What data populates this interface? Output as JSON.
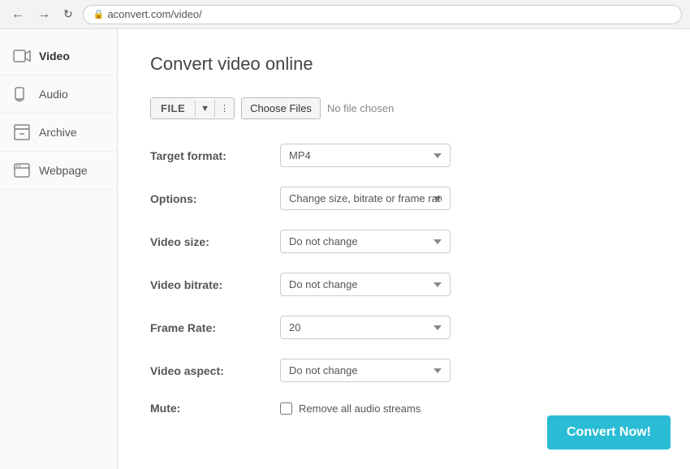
{
  "browser": {
    "url": "aconvert.com/video/"
  },
  "sidebar": {
    "items": [
      {
        "id": "video",
        "label": "Video",
        "active": true
      },
      {
        "id": "audio",
        "label": "Audio",
        "active": false
      },
      {
        "id": "archive",
        "label": "Archive",
        "active": false
      },
      {
        "id": "webpage",
        "label": "Webpage",
        "active": false
      }
    ]
  },
  "main": {
    "title": "Convert video online",
    "file_input": {
      "btn_label": "FILE",
      "choose_files_label": "Choose Files",
      "no_file_text": "No file chosen"
    },
    "form": {
      "target_format_label": "Target format:",
      "target_format_value": "MP4",
      "options_label": "Options:",
      "options_value": "Change size, bitrate or frame rate",
      "video_size_label": "Video size:",
      "video_size_value": "Do not change",
      "video_bitrate_label": "Video bitrate:",
      "video_bitrate_value": "Do not change",
      "frame_rate_label": "Frame Rate:",
      "frame_rate_value": "20",
      "video_aspect_label": "Video aspect:",
      "video_aspect_value": "Do not change",
      "mute_label": "Mute:",
      "mute_checkbox_label": "Remove all audio streams"
    },
    "convert_btn": "Convert Now!"
  }
}
